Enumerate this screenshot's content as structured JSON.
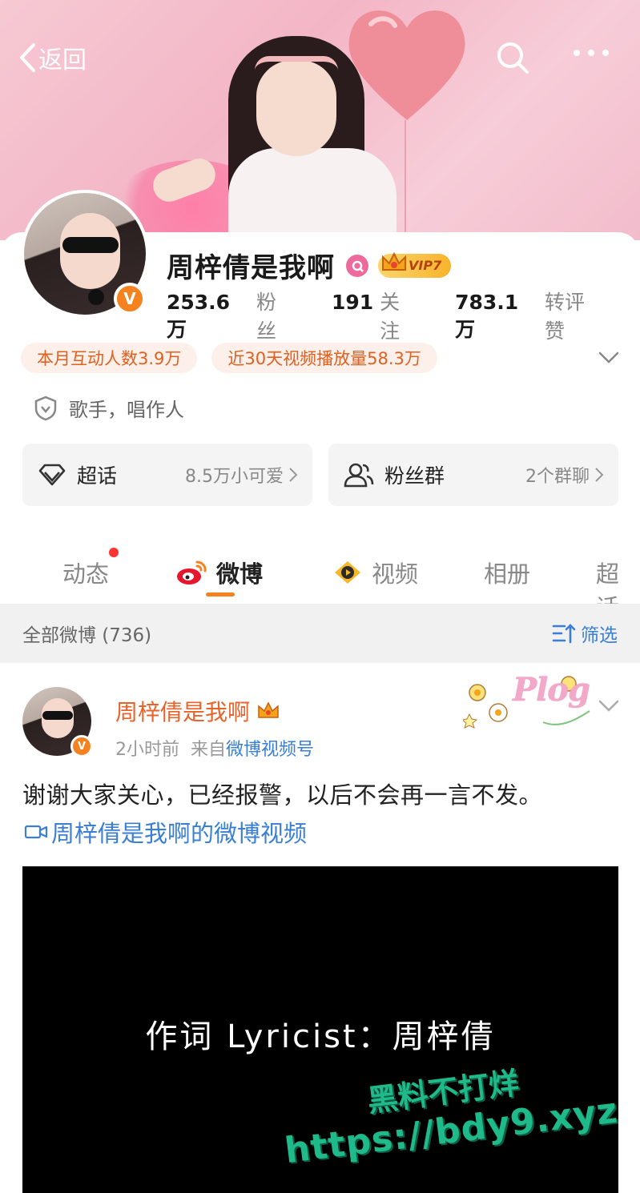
{
  "nav": {
    "back_label": "返回"
  },
  "profile": {
    "name": "周梓倩是我啊",
    "vip_label": "VIP7",
    "verified_mark": "V",
    "stats": [
      {
        "value": "253.6万",
        "label": "粉丝"
      },
      {
        "value": "191",
        "label": "关注"
      },
      {
        "value": "783.1万",
        "label": "转评赞"
      }
    ],
    "tags": [
      "本月互动人数3.9万",
      "近30天视频播放量58.3万"
    ],
    "role": "歌手，唱作人",
    "cards": [
      {
        "title": "超话",
        "sub": "8.5万小可爱"
      },
      {
        "title": "粉丝群",
        "sub": "2个群聊"
      }
    ]
  },
  "tabs": [
    {
      "label": "动态",
      "active": false,
      "badge": true
    },
    {
      "label": "微博",
      "active": true
    },
    {
      "label": "视频",
      "active": false
    },
    {
      "label": "相册",
      "active": false
    },
    {
      "label": "超话",
      "active": false
    }
  ],
  "filter": {
    "all_label": "全部微博 (736)",
    "filter_label": "筛选"
  },
  "post": {
    "author": "周梓倩是我啊",
    "time": "2小时前",
    "source_prefix": "来自",
    "source": "微博视频号",
    "sticker_text": "Plog",
    "text": "谢谢大家关心，已经报警，以后不会再一言不发。",
    "link": "周梓倩是我啊的微博视频",
    "video_caption": "作词 Lyricist：周梓倩"
  },
  "watermark": {
    "line1": "黑料不打烊",
    "line2": "https://bdy9.xyz"
  },
  "colors": {
    "accent": "#f5821f",
    "link": "#3a7fd5",
    "tag_text": "#e0601f",
    "tag_bg": "#fdf0ea"
  }
}
